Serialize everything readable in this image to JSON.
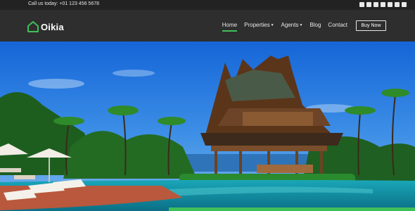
{
  "topbar": {
    "phone": "Call us today: +01 123 456 5678",
    "social_icons": [
      "facebook-icon",
      "twitter-icon",
      "linkedin-icon",
      "vimeo-icon",
      "youtube-icon",
      "dribbble-icon",
      "rss-icon"
    ]
  },
  "header": {
    "logo_text": "Oikia",
    "nav": [
      {
        "label": "Home",
        "active": true
      },
      {
        "label": "Properties",
        "dropdown": true
      },
      {
        "label": "Agents",
        "dropdown": true
      },
      {
        "label": "Blog"
      },
      {
        "label": "Contact"
      }
    ],
    "cta": "Buy Now"
  },
  "colors": {
    "accent": "#3fbf5a",
    "topbar_bg": "#222222",
    "header_bg": "#2e2e2e"
  },
  "hero": {
    "image": "tropical-resort-pool-pavilion"
  }
}
